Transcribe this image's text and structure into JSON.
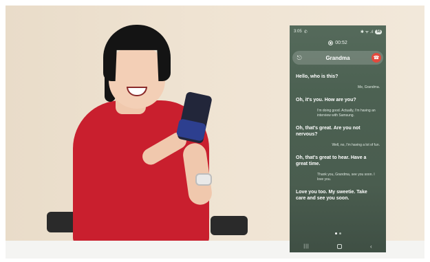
{
  "status_bar": {
    "time": "3:05",
    "signal_icon": "phone-call-icon",
    "right_indicators": "✱ ᯤ .ıl",
    "battery": "58"
  },
  "call": {
    "timer": "00:52",
    "caller": "Grandma"
  },
  "transcript": [
    {
      "speaker": "other",
      "text": "Hello, who is this?"
    },
    {
      "speaker": "me",
      "text": "Me, Grandma."
    },
    {
      "speaker": "other",
      "text": "Oh, it's you. How are you?"
    },
    {
      "speaker": "me",
      "text": "I'm doing good. Actually, I'm having an interview with Samsung."
    },
    {
      "speaker": "other",
      "text": "Oh, that's great. Are you not nervous?"
    },
    {
      "speaker": "me",
      "text": "Well, no, I'm having a lot of fun."
    },
    {
      "speaker": "other",
      "text": "Oh, that's great to hear. Have a great time."
    },
    {
      "speaker": "me",
      "text": "Thank you, Grandma, see you soon. I love you."
    },
    {
      "speaker": "other",
      "text": "Love you too. My sweetie. Take care and see you soon."
    }
  ],
  "colors": {
    "screen_bg": "#4c6152",
    "end_call": "#e24a3e",
    "shirt": "#c91f2e"
  }
}
